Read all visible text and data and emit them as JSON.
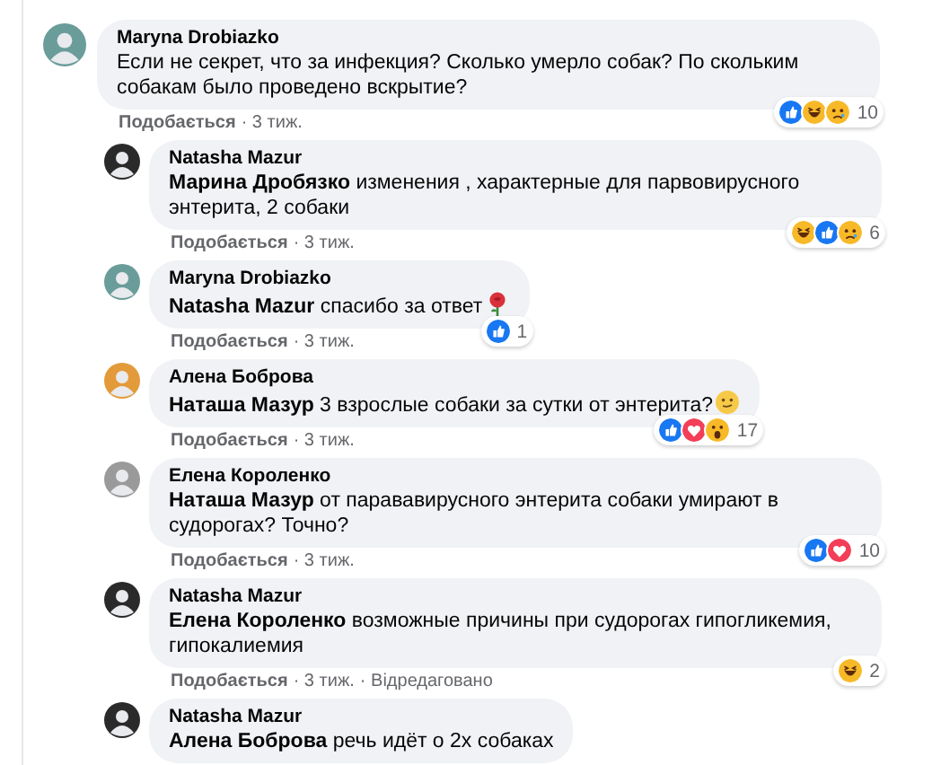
{
  "comments": [
    {
      "author": "Maryna Drobiazko",
      "color": "#6a9c9a",
      "reply": false,
      "text": "Если не секрет, что за инфекция? Сколько умерло собак? По скольким собакам было проведено вскрытие?",
      "reactions": [
        {
          "kind": "like"
        },
        {
          "kind": "haha"
        },
        {
          "kind": "sad"
        }
      ],
      "reaction_count": "10",
      "like_label": "Подобається",
      "time": "· 3 тиж."
    },
    {
      "author": "Natasha Mazur",
      "color": "#2a2a2a",
      "reply": true,
      "text": "**Марина Дробязко** изменения , характерные для парвовирусного энтерита, 2 собаки",
      "reactions": [
        {
          "kind": "haha"
        },
        {
          "kind": "like"
        },
        {
          "kind": "sad"
        }
      ],
      "reaction_count": "6",
      "like_label": "Подобається",
      "time": "· 3 тиж."
    },
    {
      "author": "Maryna Drobiazko",
      "color": "#6a9c9a",
      "reply": true,
      "text": "**Natasha Mazur** спасибо за ответ",
      "emoji": {
        "kind": "rose"
      },
      "reactions": [
        {
          "kind": "like"
        }
      ],
      "reaction_count": "1",
      "like_label": "Подобається",
      "time": "· 3 тиж."
    },
    {
      "author": "Алена Боброва",
      "color": "#e39a3a",
      "reply": true,
      "text": "**Наташа Мазур** 3 взрослые собаки за сутки от энтерита?",
      "emoji": {
        "kind": "smile"
      },
      "reactions": [
        {
          "kind": "like"
        },
        {
          "kind": "love"
        },
        {
          "kind": "wow"
        }
      ],
      "reaction_count": "17",
      "like_label": "Подобається",
      "time": "· 3 тиж."
    },
    {
      "author": "Елена Короленко",
      "color": "#9a9a9a",
      "reply": true,
      "text": "**Наташа Мазур** от парававирусного энтерита собаки умирают в судорогах? Точно?",
      "reactions": [
        {
          "kind": "like"
        },
        {
          "kind": "love"
        }
      ],
      "reaction_count": "10",
      "like_label": "Подобається",
      "time": "· 3 тиж."
    },
    {
      "author": "Natasha Mazur",
      "color": "#2a2a2a",
      "reply": true,
      "text": "**Елена Короленко** возможные причины при судорогах гипогликемия, гипокалиемия",
      "reactions": [
        {
          "kind": "haha"
        }
      ],
      "reaction_count": "2",
      "like_label": "Подобається",
      "time": "· 3 тиж.",
      "edited": "· Відредаговано"
    },
    {
      "author": "Natasha Mazur",
      "color": "#2a2a2a",
      "reply": true,
      "text": "**Алена Боброва** речь идёт о 2х собаках"
    }
  ]
}
